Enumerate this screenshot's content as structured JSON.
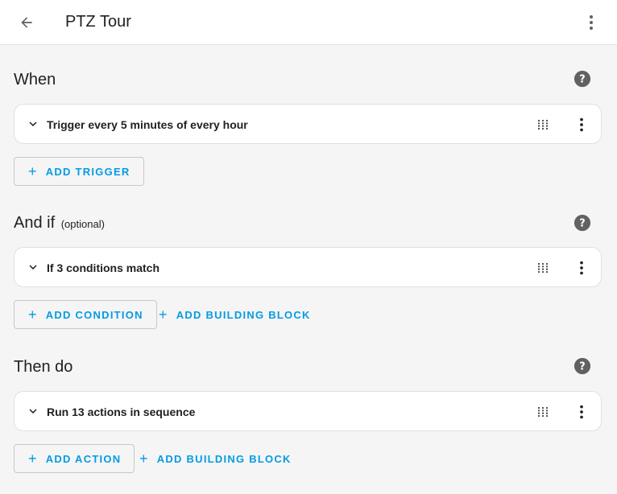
{
  "header": {
    "title": "PTZ Tour"
  },
  "sections": [
    {
      "heading": "When",
      "card_label": "Trigger every 5 minutes of every hour",
      "primary_button": "ADD TRIGGER"
    },
    {
      "heading": "And if",
      "optional": "(optional)",
      "card_label": "If 3 conditions match",
      "primary_button": "ADD CONDITION",
      "secondary_button": "ADD BUILDING BLOCK"
    },
    {
      "heading": "Then do",
      "card_label": "Run 13 actions in sequence",
      "primary_button": "ADD ACTION",
      "secondary_button": "ADD BUILDING BLOCK"
    }
  ],
  "icons": {
    "back": "arrow-left-icon",
    "menu": "dots-vertical-icon",
    "help": "help-circle-icon",
    "expand": "chevron-down-icon",
    "drag": "drag-handle-icon",
    "plus": "plus-icon"
  },
  "colors": {
    "accent": "#039be5",
    "background": "#f5f5f5",
    "card": "#ffffff",
    "icon": "#616161"
  }
}
